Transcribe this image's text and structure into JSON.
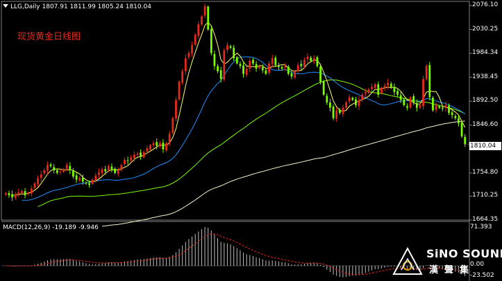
{
  "header": {
    "symbol_line": "LLG,Daily  1807.91 1811.99 1805.24 1810.04"
  },
  "chart_title": "现货黄金日线图",
  "price_axis": {
    "labels": [
      "2076.10",
      "2030.25",
      "1984.34",
      "1938.45",
      "1892.50",
      "1846.60",
      "1800.70",
      "1754.80",
      "1710.25",
      "1664.35"
    ],
    "current_price": "1810.04"
  },
  "macd": {
    "label": "MACD(12,26,9) -19.189 -9.946",
    "axis_top": "71.393",
    "axis_zero": "0.00",
    "axis_bottom": "-23.502"
  },
  "logo": {
    "brand": "SiNO SOUND",
    "brand_cn": "漢聲集"
  },
  "colors": {
    "background": "#000000",
    "up_candle": "#e8291c",
    "down_candle": "#7CFC00",
    "ma_fast": "#ffff66",
    "ma_medium": "#1e90ff",
    "ma_slow": "#7cfc00",
    "ma_long": "#f5f5c8",
    "macd_signal": "#e8291c",
    "macd_hist": "#c0c0c0"
  },
  "chart_data": {
    "type": "candlestick",
    "ylim": [
      1664.35,
      2076.1
    ],
    "close": [
      1716,
      1712,
      1708,
      1714,
      1718,
      1720,
      1712,
      1716,
      1725,
      1735,
      1745,
      1752,
      1760,
      1770,
      1768,
      1760,
      1755,
      1758,
      1762,
      1770,
      1760,
      1748,
      1742,
      1745,
      1738,
      1735,
      1732,
      1742,
      1750,
      1756,
      1762,
      1758,
      1768,
      1762,
      1755,
      1760,
      1770,
      1780,
      1778,
      1785,
      1790,
      1792,
      1786,
      1795,
      1802,
      1808,
      1812,
      1807,
      1812,
      1800,
      1812,
      1830,
      1860,
      1895,
      1930,
      1950,
      1975,
      1985,
      2000,
      2020,
      2040,
      2055,
      2075,
      2030,
      1985,
      1960,
      1950,
      1935,
      1990,
      2000,
      1995,
      1975,
      1965,
      1960,
      1945,
      1955,
      1970,
      1965,
      1955,
      1960,
      1952,
      1945,
      1965,
      1975,
      1962,
      1958,
      1955,
      1960,
      1945,
      1940,
      1950,
      1962,
      1960,
      1972,
      1978,
      1970,
      1975,
      1960,
      1930,
      1905,
      1890,
      1880,
      1860,
      1875,
      1870,
      1880,
      1890,
      1900,
      1895,
      1885,
      1895,
      1905,
      1910,
      1915,
      1920,
      1925,
      1905,
      1918,
      1922,
      1928,
      1920,
      1910,
      1905,
      1895,
      1885,
      1880,
      1900,
      1890,
      1880,
      1885,
      1935,
      1960,
      1900,
      1875,
      1885,
      1880,
      1878,
      1885,
      1870,
      1866,
      1860,
      1850,
      1825,
      1810
    ]
  }
}
